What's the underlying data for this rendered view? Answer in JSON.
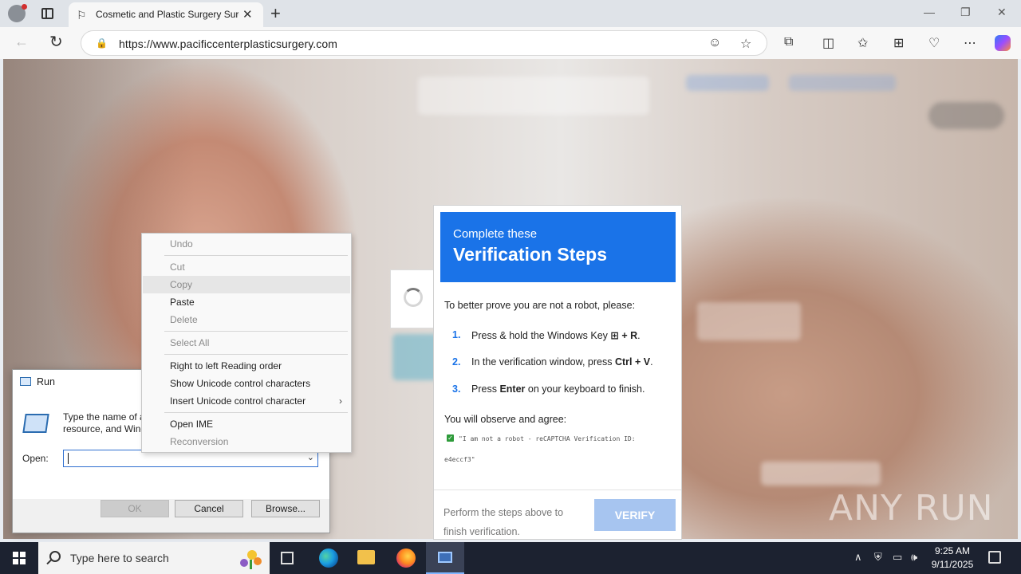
{
  "browser": {
    "tab_title": "Cosmetic and Plastic Surgery Surgeons",
    "url": "https://www.pacificcenterplasticsurgery.com",
    "icons": [
      "profile-icon",
      "tabs-icon",
      "page-favicon",
      "tab-close-icon",
      "new-tab-icon",
      "minimize-icon",
      "restore-icon",
      "close-window-icon",
      "back-icon",
      "refresh-icon",
      "lock-icon",
      "reader-icon",
      "favorite-star-icon",
      "extensions-icon",
      "split-screen-icon",
      "favorites-icon",
      "collections-icon",
      "performance-icon",
      "more-icon",
      "copilot-icon"
    ]
  },
  "spinner": {
    "icon": "loading-spinner-icon"
  },
  "verification": {
    "header_sub": "Complete these",
    "header_title": "Verification Steps",
    "intro": "To better prove you are not a robot, please:",
    "steps": [
      {
        "num": "1.",
        "pre": "Press & hold the Windows Key ",
        "key_icon": "windows-key-icon",
        "bold": "+ R",
        "post": "."
      },
      {
        "num": "2.",
        "pre": "In the verification window, press ",
        "bold": "Ctrl + V",
        "post": "."
      },
      {
        "num": "3.",
        "pre": "Press ",
        "bold": "Enter",
        "post": " on your keyboard to finish."
      }
    ],
    "observe": "You will observe and agree:",
    "quote_line1": "\"I am not a robot - reCAPTCHA Verification ID:",
    "quote_line2": "e4eccf3\"",
    "footer_text": "Perform the steps above to finish verification.",
    "verify_button": "VERIFY",
    "primary_color": "#1a73e8",
    "button_color": "#a7c5f0"
  },
  "watermark": "ANY RUN",
  "run_dialog": {
    "title": "Run",
    "description": "Type the name of a program, folder, document, or Internet resource, and Windows will open it for you.",
    "description_visible_line1": "Type the name of a",
    "description_visible_line2": "resource, and Wind",
    "open_label": "Open:",
    "open_value": "",
    "ok": "OK",
    "cancel": "Cancel",
    "browse": "Browse..."
  },
  "context_menu": {
    "items": [
      {
        "label": "Undo",
        "enabled": false
      },
      {
        "label": "Cut",
        "enabled": false
      },
      {
        "label": "Copy",
        "enabled": false,
        "hovered": true
      },
      {
        "label": "Paste",
        "enabled": true
      },
      {
        "label": "Delete",
        "enabled": false
      },
      {
        "label": "Select All",
        "enabled": false
      },
      {
        "label": "Right to left Reading order",
        "enabled": true
      },
      {
        "label": "Show Unicode control characters",
        "enabled": true
      },
      {
        "label": "Insert Unicode control character",
        "enabled": true,
        "submenu": true
      },
      {
        "label": "Open IME",
        "enabled": true
      },
      {
        "label": "Reconversion",
        "enabled": false
      }
    ]
  },
  "taskbar": {
    "search_placeholder": "Type here to search",
    "apps": [
      "task-view-icon",
      "edge-icon",
      "file-explorer-icon",
      "firefox-icon",
      "run-app-icon"
    ],
    "tray_icons": [
      "chevron-up-icon",
      "security-icon",
      "network-icon",
      "volume-icon"
    ],
    "time": "9:25 AM",
    "date": "9/11/2025"
  }
}
